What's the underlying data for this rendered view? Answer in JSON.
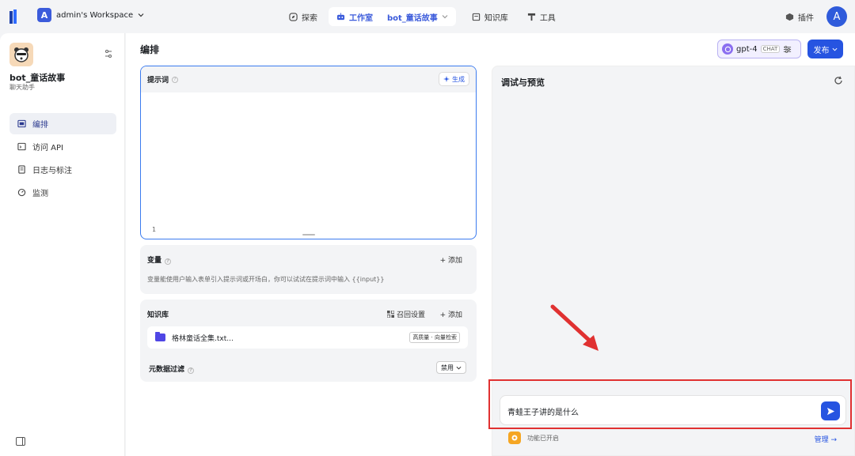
{
  "topbar": {
    "workspace_initial": "A",
    "workspace_name": "admin's Workspace",
    "nav": [
      {
        "label": "探索"
      },
      {
        "label": "工作室"
      },
      {
        "label": "bot_童话故事"
      },
      {
        "label": "知识库"
      },
      {
        "label": "工具"
      }
    ],
    "plugin_label": "插件",
    "avatar_initial": "A"
  },
  "sidebar": {
    "bot_title": "bot_童话故事",
    "bot_subtitle": "聊天助手",
    "items": [
      {
        "label": "编排",
        "icon": "layout-icon"
      },
      {
        "label": "访问 API",
        "icon": "terminal-icon"
      },
      {
        "label": "日志与标注",
        "icon": "doc-icon"
      },
      {
        "label": "监测",
        "icon": "gauge-icon"
      }
    ]
  },
  "main": {
    "title": "编排",
    "model": {
      "name": "gpt-4",
      "tag": "CHAT"
    },
    "publish_label": "发布",
    "prompt": {
      "label": "提示词",
      "generate_label": "生成",
      "line_number": "1"
    },
    "variables": {
      "label": "变量",
      "add_label": "添加",
      "description": "变量能使用户输入表单引入提示词或开场白，你可以试试在提示词中输入 {{input}}"
    },
    "knowledge": {
      "label": "知识库",
      "recall_label": "召回设置",
      "add_label": "添加",
      "file_name": "格林童话全集.txt...",
      "file_tag": "高质量 · 向量检索",
      "metadata_label": "元数据过滤",
      "metadata_value": "禁用"
    }
  },
  "debug": {
    "title": "调试与预览",
    "input_value": "青蛙王子讲的是什么",
    "feature_text": "功能已开启",
    "manage_label": "管理 →"
  },
  "colors": {
    "accent": "#2654e1",
    "highlight": "#e03131"
  }
}
